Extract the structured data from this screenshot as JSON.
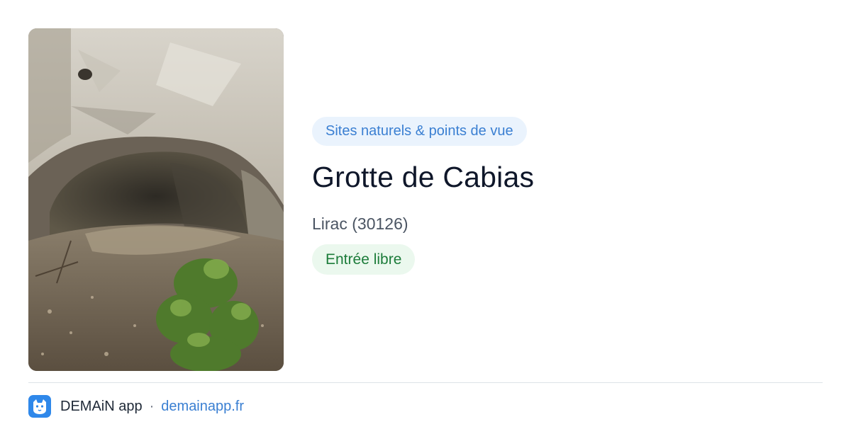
{
  "card": {
    "category": "Sites naturels & points de vue",
    "title": "Grotte de Cabias",
    "location": "Lirac (30126)",
    "access_badge": "Entrée libre"
  },
  "footer": {
    "app_name": "DEMAiN app",
    "separator": "·",
    "url": "demainapp.fr"
  },
  "icons": {
    "app_logo": "demain-app-logo-icon"
  },
  "colors": {
    "category_bg": "#eaf3fd",
    "category_text": "#3a7fd2",
    "access_bg": "#ebf8ee",
    "access_text": "#1c7c3a",
    "link": "#3a7fd2",
    "logo": "#2f88ea"
  }
}
